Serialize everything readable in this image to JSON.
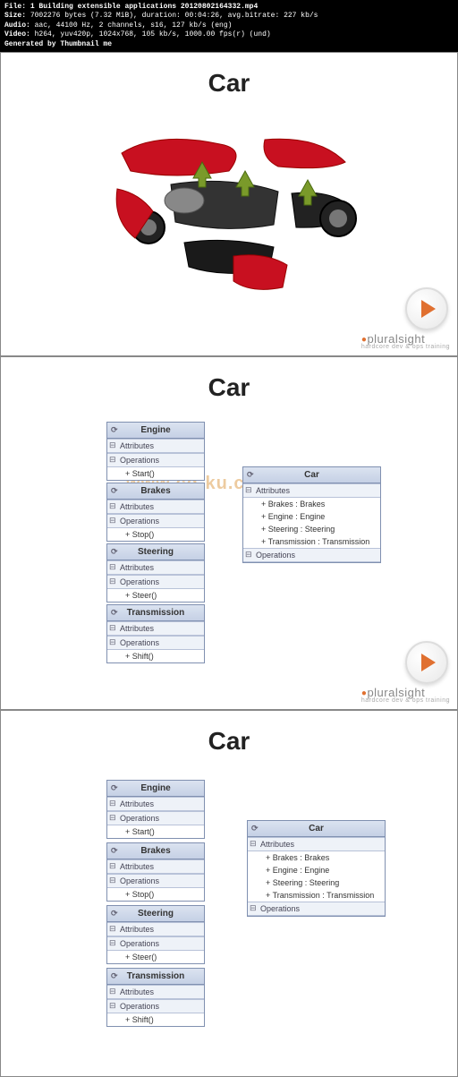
{
  "header": {
    "file_label": "File:",
    "file_value": "1 Building extensible applications 20120802164332.mp4",
    "size_label": "Size:",
    "size_value": "7002276 bytes (7.32 MiB), duration: 00:04:26, avg.bitrate: 227 kb/s",
    "audio_label": "Audio:",
    "audio_value": "aac, 44100 Hz, 2 channels, s16, 127 kb/s (eng)",
    "video_label": "Video:",
    "video_value": "h264, yuv420p, 1024x768, 105 kb/s, 1000.00 fps(r) (und)",
    "generated": "Generated by Thumbnail me"
  },
  "panels": {
    "title": "Car",
    "brand": "pluralsight",
    "brand_sub": "hardcore dev & ops training"
  },
  "watermark": "www.cg-ku.com",
  "uml": {
    "attributes_label": "Attributes",
    "operations_label": "Operations",
    "engine": {
      "name": "Engine",
      "op": "+ Start()"
    },
    "brakes": {
      "name": "Brakes",
      "op": "+ Stop()"
    },
    "steering": {
      "name": "Steering",
      "op": "+ Steer()"
    },
    "transmission": {
      "name": "Transmission",
      "op": "+ Shift()"
    },
    "car": {
      "name": "Car",
      "attrs": [
        "+ Brakes : Brakes",
        "+ Engine : Engine",
        "+ Steering : Steering",
        "+ Transmission : Transmission"
      ]
    }
  }
}
